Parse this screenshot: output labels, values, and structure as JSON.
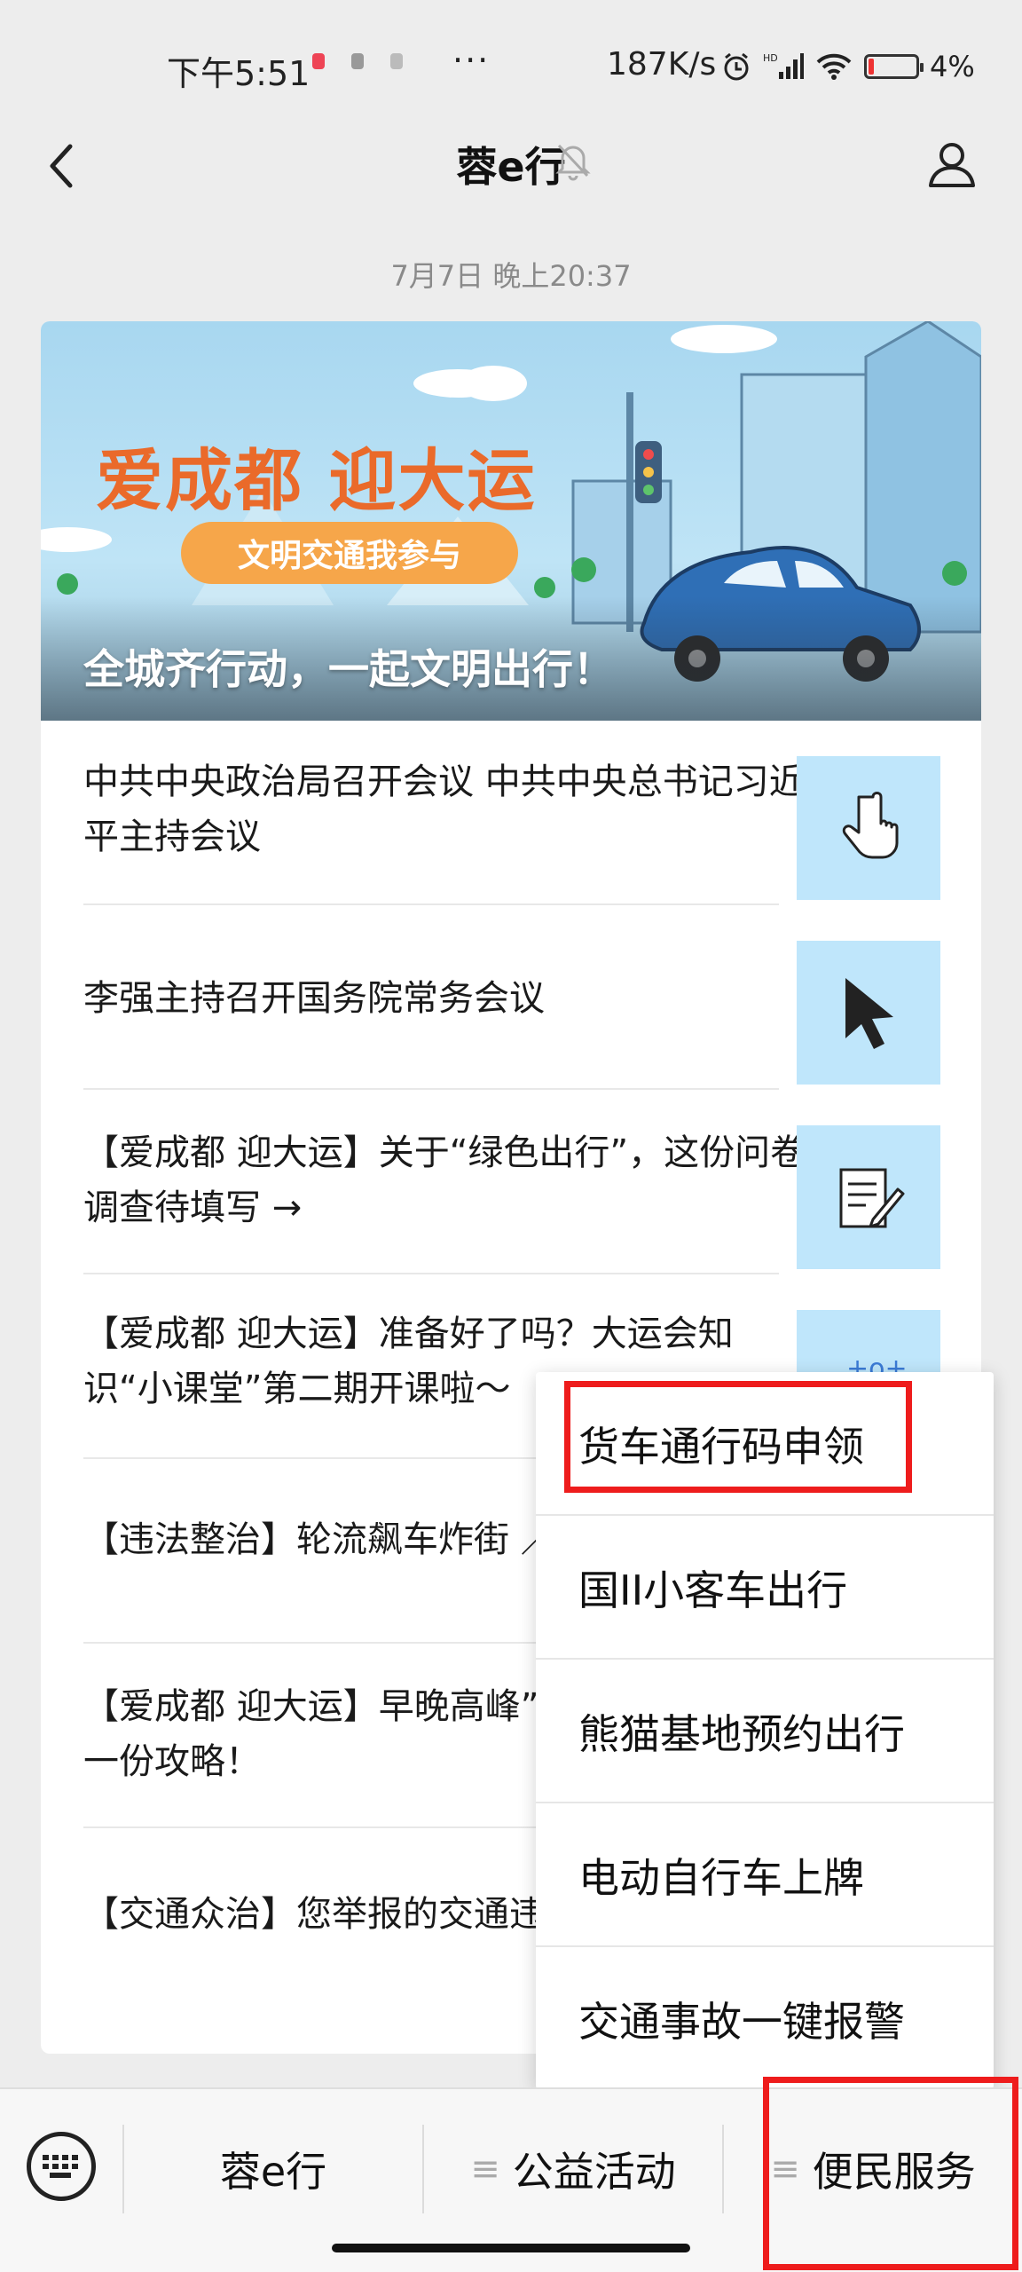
{
  "status_bar": {
    "time": "下午5:51",
    "more": "···",
    "speed": "187K/s",
    "battery_pct": "4%",
    "network_label": "HD"
  },
  "header": {
    "title": "蓉e行",
    "back_icon": "chevron-left-icon",
    "mute_icon": "bell-muted-icon",
    "profile_icon": "person-icon"
  },
  "timestamp": "7月7日 晚上20:37",
  "banner": {
    "title": "爱成都 迎大运",
    "pill": "文明交通我参与",
    "caption": "全城齐行动，一起文明出行！"
  },
  "articles": [
    {
      "text": "中共中央政治局召开会议 中共中央总书记习近平主持会议",
      "icon": "hand-pointer-icon"
    },
    {
      "text": "李强主持召开国务院常务会议",
      "icon": "cursor-arrow-icon"
    },
    {
      "text": "【爱成都 迎大运】关于“绿色出行”，这份问卷调查待填写 →",
      "icon": "document-edit-icon"
    },
    {
      "text": "【爱成都 迎大运】准备好了吗？大运会知识“小课堂”第二期开课啦～",
      "icon": "sparkle-icon"
    },
    {
      "text": "【违法整治】轮流飙车炸街 ／",
      "icon": ""
    },
    {
      "text": "【爱成都 迎大运】早晚高峰”，你需要的是这一份攻略！",
      "icon": ""
    },
    {
      "text": "【交通众治】您举报的交通违",
      "icon": ""
    }
  ],
  "popup_menu": {
    "items": [
      "货车通行码申领",
      "国II小客车出行",
      "熊猫基地预约出行",
      "电动自行车上牌",
      "交通事故一键报警"
    ],
    "highlighted_index": 0
  },
  "bottom_menu": {
    "keyboard_icon": "keyboard-icon",
    "items": [
      "蓉e行",
      "公益活动",
      "便民服务"
    ],
    "menu_marker": "≡"
  },
  "colors": {
    "highlight": "#ee1c1c",
    "thumb_bg": "#bfe6fb",
    "banner_title": "#ea6a2a",
    "banner_pill": "#f6a64a"
  }
}
